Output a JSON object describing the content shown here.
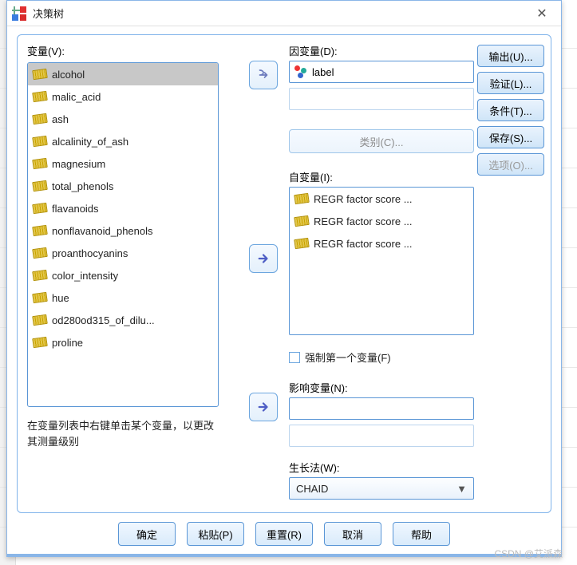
{
  "window": {
    "title": "决策树",
    "close_glyph": "✕"
  },
  "labels": {
    "variables": "变量(V):",
    "dependent": "因变量(D):",
    "categories": "类别(C)...",
    "independent": "自变量(I):",
    "force_first": "强制第一个变量(F)",
    "influence": "影响变量(N):",
    "growth_method": "生长法(W):",
    "hint": "在变量列表中右键单击某个变量，以更改其测量级别"
  },
  "variables": [
    "alcohol",
    "malic_acid",
    "ash",
    "alcalinity_of_ash",
    "magnesium",
    "total_phenols",
    "flavanoids",
    "nonflavanoid_phenols",
    "proanthocyanins",
    "color_intensity",
    "hue",
    "od280od315_of_dilu...",
    "proline"
  ],
  "selected_variable_index": 0,
  "dependent_variable": "label",
  "independent_variables": [
    "REGR factor score  ...",
    "REGR factor score  ...",
    "REGR factor score  ..."
  ],
  "force_first_checked": false,
  "influence_variable": "",
  "growth_method_value": "CHAID",
  "side_buttons": {
    "output": "输出(U)...",
    "validate": "验证(L)...",
    "criteria": "条件(T)...",
    "save": "保存(S)...",
    "options": "选项(O)..."
  },
  "bottom_buttons": {
    "ok": "确定",
    "paste": "粘贴(P)",
    "reset": "重置(R)",
    "cancel": "取消",
    "help": "帮助"
  },
  "watermark": "CSDN @艾派森"
}
